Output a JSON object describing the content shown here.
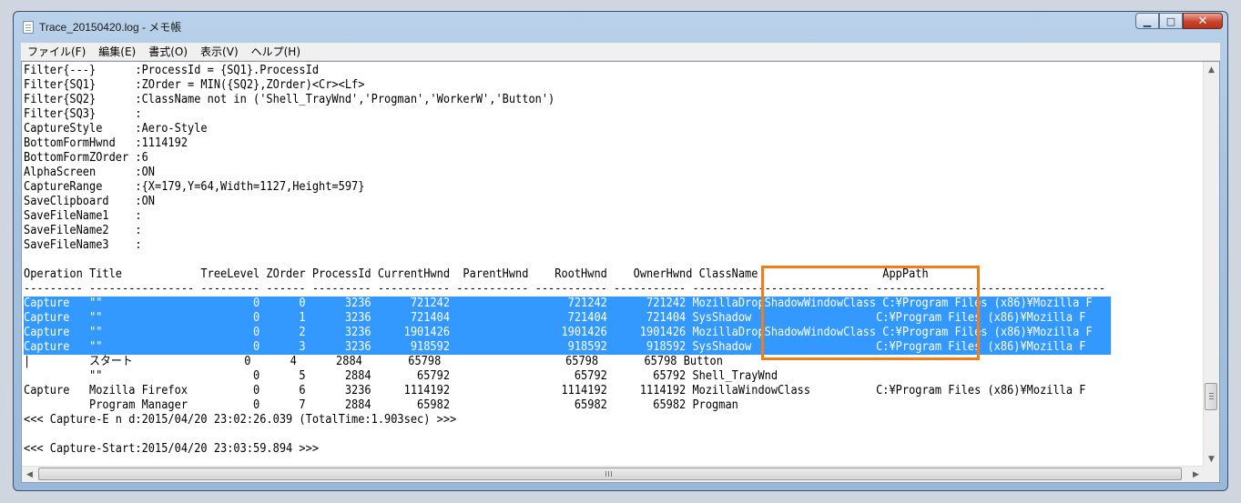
{
  "window": {
    "title": "Trace_20150420.log - メモ帳",
    "buttons": {
      "minimize": "▁",
      "maximize": "□",
      "close": "✕"
    }
  },
  "menu": [
    "ファイル(F)",
    "編集(E)",
    "書式(O)",
    "表示(V)",
    "ヘルプ(H)"
  ],
  "editor": {
    "lines": [
      "Filter{---}      :ProcessId = {SQ1}.ProcessId",
      "Filter{SQ1}      :ZOrder = MIN({SQ2},ZOrder)<Cr><Lf>",
      "Filter{SQ2}      :ClassName not in ('Shell_TrayWnd','Progman','WorkerW','Button')",
      "Filter{SQ3}      :",
      "CaptureStyle     :Aero-Style",
      "BottomFormHwnd   :1114192",
      "BottomFormZOrder :6",
      "AlphaScreen      :ON",
      "CaptureRange     :{X=179,Y=64,Width=1127,Height=597}",
      "SaveClipboard    :ON",
      "SaveFileName1    :",
      "SaveFileName2    :",
      "SaveFileName3    :",
      "",
      "Operation Title            TreeLevel ZOrder ProcessId CurrentHwnd  ParentHwnd    RootHwnd    OwnerHwnd ClassName                   AppPath",
      "--------- ---------------- --------- ------ --------- ----------- ----------- ----------- ----------- --------------------------- -----------------------------------",
      "Capture   \"\"                       0      0      3236      721242                  721242      721242 MozillaDropShadowWindowClass C:¥Program Files (x86)¥Mozilla F",
      "Capture   \"\"                       0      1      3236      721404                  721404      721404 SysShadow                   C:¥Program Files (x86)¥Mozilla F",
      "Capture   \"\"                       0      2      3236     1901426                 1901426     1901426 MozillaDropShadowWindowClass C:¥Program Files (x86)¥Mozilla F",
      "Capture   \"\"                       0      3      3236      918592                  918592      918592 SysShadow                   C:¥Program Files (x86)¥Mozilla F",
      "|         スタート                 0      4      2884       65798                   65798       65798 Button",
      "          \"\"                       0      5      2884       65792                   65792       65792 Shell_TrayWnd",
      "Capture   Mozilla Firefox          0      6      3236     1114192                 1114192     1114192 MozillaWindowClass          C:¥Program Files (x86)¥Mozilla F",
      "          Program Manager          0      7      2884       65982                   65982       65982 Progman",
      "<<< Capture-E n d:2015/04/20 23:02:26.039 (TotalTime:1.903sec) >>>",
      "",
      "<<< Capture-Start:2015/04/20 23:03:59.894 >>>"
    ],
    "selected_lines": [
      16,
      17,
      18,
      19
    ]
  }
}
